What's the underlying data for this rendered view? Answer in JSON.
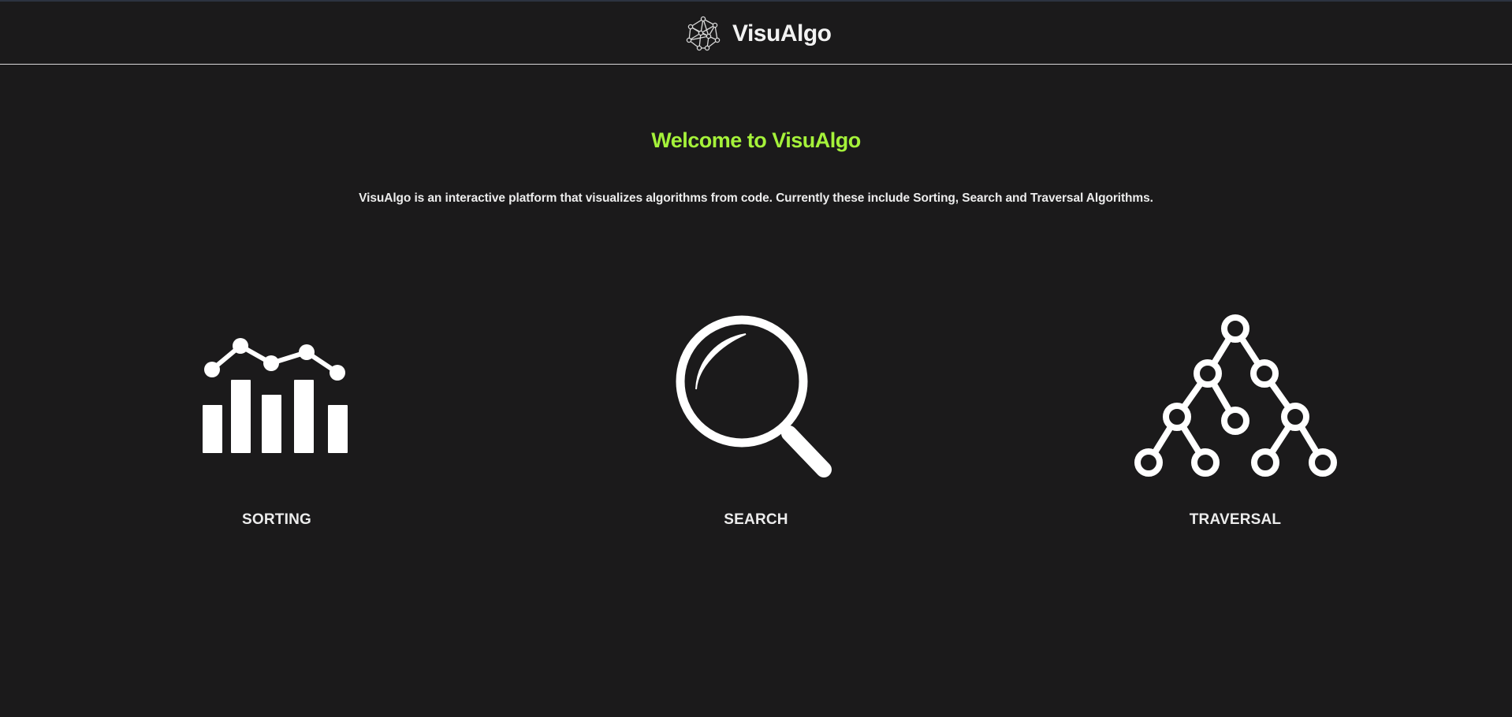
{
  "header": {
    "brand_name": "VisuAlgo",
    "logo_icon": "network-graph-icon"
  },
  "main": {
    "welcome_title": "Welcome to VisuAlgo",
    "intro_text": "VisuAlgo is an interactive platform that visualizes algorithms from code. Currently these include Sorting, Search and Traversal Algorithms.",
    "accent_color": "#a5f23a",
    "background_color": "#1b1a1b"
  },
  "categories": [
    {
      "label": "SORTING",
      "icon": "bar-chart-icon"
    },
    {
      "label": "SEARCH",
      "icon": "magnifier-icon"
    },
    {
      "label": "TRAVERSAL",
      "icon": "tree-icon"
    }
  ]
}
